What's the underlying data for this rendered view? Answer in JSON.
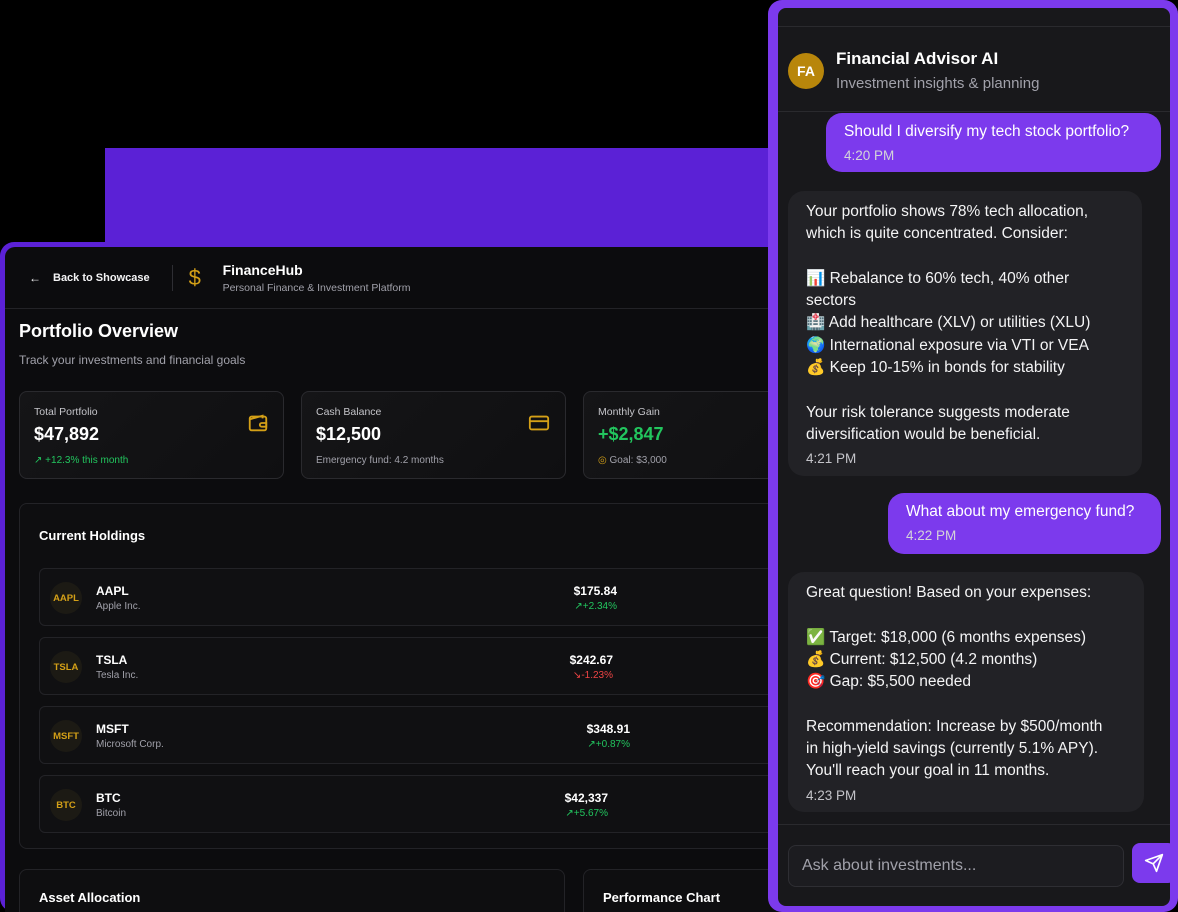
{
  "app": {
    "back_label": "Back to Showcase",
    "brand_name": "FinanceHub",
    "brand_sub": "Personal Finance & Investment Platform",
    "page_title": "Portfolio Overview",
    "page_sub": "Track your investments and financial goals"
  },
  "stats": [
    {
      "label": "Total Portfolio",
      "value": "$47,892",
      "note": "+12.3% this month",
      "icon": "wallet-icon"
    },
    {
      "label": "Cash Balance",
      "value": "$12,500",
      "note": "Emergency fund: 4.2 months",
      "icon": "credit-card-icon"
    },
    {
      "label": "Monthly Gain",
      "value": "+$2,847",
      "note": "Goal: $3,000",
      "icon": "target-icon"
    }
  ],
  "holdings": {
    "title": "Current Holdings",
    "rows": [
      {
        "symbol": "AAPL",
        "name": "Apple Inc.",
        "price": "$175.84",
        "change": "+2.34%",
        "direction": "up"
      },
      {
        "symbol": "TSLA",
        "name": "Tesla Inc.",
        "price": "$242.67",
        "change": "-1.23%",
        "direction": "down"
      },
      {
        "symbol": "MSFT",
        "name": "Microsoft Corp.",
        "price": "$348.91",
        "change": "+0.87%",
        "direction": "up"
      },
      {
        "symbol": "BTC",
        "name": "Bitcoin",
        "price": "$42,337",
        "change": "+5.67%",
        "direction": "up"
      }
    ]
  },
  "sections": {
    "allocation_title": "Asset Allocation",
    "performance_title": "Performance Chart"
  },
  "chat": {
    "avatar_initials": "FA",
    "title": "Financial Advisor AI",
    "subtitle": "Investment insights & planning",
    "messages": [
      {
        "role": "user",
        "lines": [
          "Should I diversify my tech stock portfolio?"
        ],
        "time": "4:20 PM"
      },
      {
        "role": "ai",
        "lines": [
          "Your portfolio shows 78% tech allocation,",
          "which is quite concentrated. Consider:",
          "",
          "📊 Rebalance to 60% tech, 40% other",
          "sectors",
          "🏥 Add healthcare (XLV) or utilities (XLU)",
          "🌍 International exposure via VTI or VEA",
          "💰 Keep 10-15% in bonds for stability",
          "",
          "Your risk tolerance suggests moderate",
          "diversification would be beneficial."
        ],
        "time": "4:21 PM"
      },
      {
        "role": "user",
        "lines": [
          "What about my emergency fund?"
        ],
        "time": "4:22 PM"
      },
      {
        "role": "ai",
        "lines": [
          "Great question! Based on your expenses:",
          "",
          "✅ Target: $18,000 (6 months expenses)",
          "💰 Current: $12,500 (4.2 months)",
          "🎯 Gap: $5,500 needed",
          "",
          "Recommendation: Increase by $500/month",
          "in high-yield savings (currently 5.1% APY).",
          "You'll reach your goal in 11 months."
        ],
        "time": "4:23 PM"
      }
    ],
    "input_placeholder": "Ask about investments..."
  },
  "colors": {
    "accent": "#7c3aed",
    "gold": "#d4a017",
    "positive": "#22c55e",
    "negative": "#ef4444",
    "background": "#0c0c0e"
  }
}
